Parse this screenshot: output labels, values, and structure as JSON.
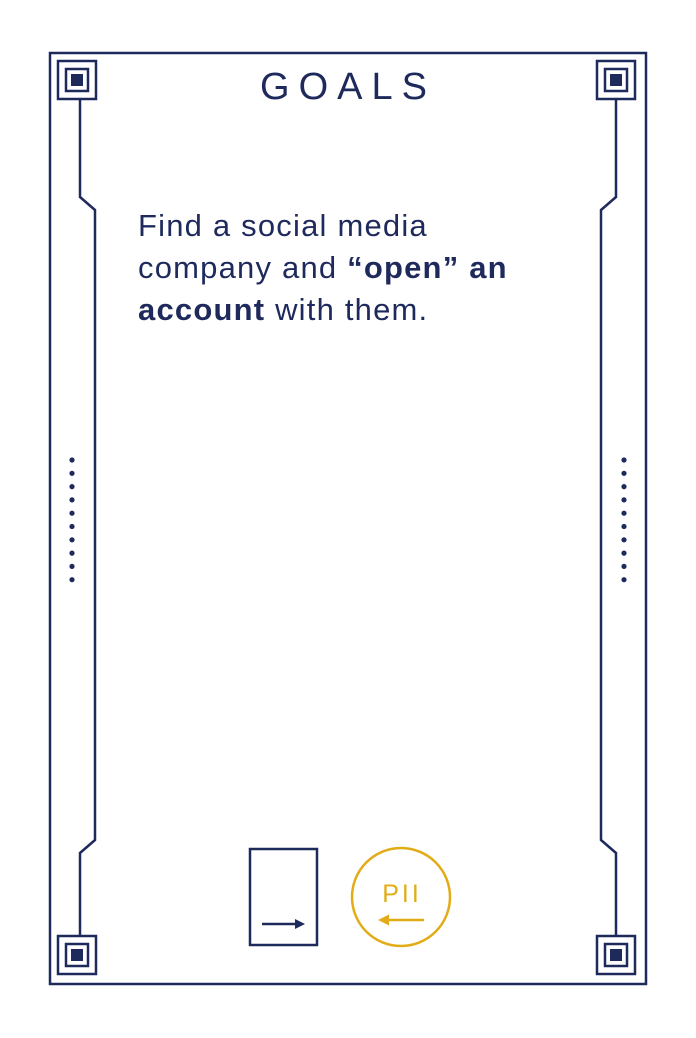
{
  "card": {
    "title": "GOALS",
    "goal": {
      "part1": "Find a social media company and ",
      "bold1": "“open” an account",
      "part2": " with them."
    },
    "badges": {
      "pii_label": "PII"
    }
  },
  "colors": {
    "navy": "#1f2a5c",
    "gold": "#e2ac17",
    "background": "#ffffff"
  },
  "icons": {
    "corners": "square-target-icon",
    "card_icon": "card-arrow-right-icon",
    "pii_icon": "pii-circle-arrow-left-icon",
    "side_dots": "dotted-line-icon"
  }
}
